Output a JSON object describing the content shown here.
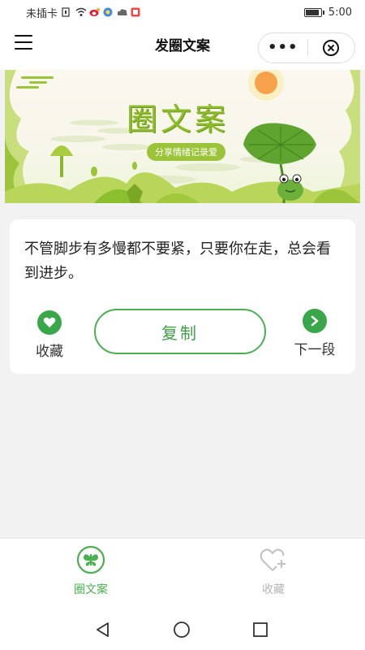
{
  "status_bar": {
    "carrier": "未插卡",
    "time": "5:00"
  },
  "nav": {
    "title": "发圈文案",
    "more_label": "•••"
  },
  "banner": {
    "title": "圈文案",
    "subtitle": "分享情绪记录爱"
  },
  "card": {
    "quote": "不管脚步有多慢都不要紧，只要你在走，总会看到进步。",
    "favorite_label": "收藏",
    "copy_label": "复制",
    "next_label": "下一段"
  },
  "tabs": [
    {
      "label": "圈文案",
      "icon": "butterfly-icon",
      "active": true
    },
    {
      "label": "收藏",
      "icon": "heart-plus-icon",
      "active": false
    }
  ],
  "colors": {
    "accent": "#4caf50",
    "accent_dark": "#3aa64a",
    "inactive": "#b5b5b5"
  }
}
